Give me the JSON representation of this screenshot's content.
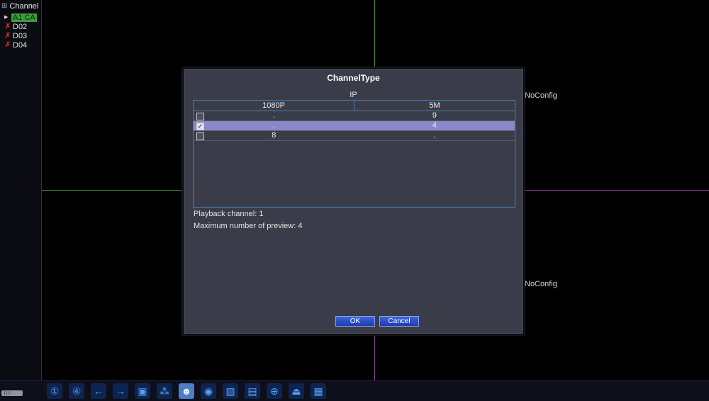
{
  "sidebar": {
    "header_glyph": "⊞",
    "title": "Channel",
    "items": [
      {
        "name": "A1",
        "glyph": "▶",
        "label": "A1 CA",
        "state": "selected"
      },
      {
        "name": "D02",
        "glyph": "✗",
        "label": "D02",
        "state": "no-signal"
      },
      {
        "name": "D03",
        "glyph": "✗",
        "label": "D03",
        "state": "no-signal"
      },
      {
        "name": "D04",
        "glyph": "✗",
        "label": "D04",
        "state": "no-signal"
      }
    ]
  },
  "video": {
    "overlays": [
      {
        "label": "NoConfig",
        "position": "top-right"
      },
      {
        "label": "NoConfig",
        "position": "bottom-right"
      }
    ]
  },
  "dialog": {
    "title": "ChannelType",
    "section_label": "IP",
    "table": {
      "columns": [
        "1080P",
        "5M"
      ],
      "rows": [
        {
          "check": "",
          "checked": false,
          "selected": false,
          "values": [
            ".",
            "9"
          ]
        },
        {
          "check": "✓",
          "checked": true,
          "selected": true,
          "values": [
            ".",
            "4"
          ]
        },
        {
          "check": "",
          "checked": false,
          "selected": false,
          "values": [
            "8",
            "."
          ]
        }
      ]
    },
    "info_lines": [
      "Playback channel: 1",
      "Maximum number of preview: 4"
    ],
    "buttons": {
      "ok": "OK",
      "cancel": "Cancel"
    }
  },
  "toolbar": {
    "buttons": [
      {
        "name": "single-screen-view",
        "glyph": "①"
      },
      {
        "name": "quad-screen-view",
        "glyph": "④"
      },
      {
        "name": "previous-page",
        "glyph": "←"
      },
      {
        "name": "next-page",
        "glyph": "→"
      },
      {
        "name": "pip-view",
        "glyph": "▣"
      },
      {
        "name": "tour",
        "glyph": "⁂"
      },
      {
        "name": "account",
        "glyph": "☻",
        "active": true
      },
      {
        "name": "ptz-control",
        "glyph": "◉"
      },
      {
        "name": "color-setting",
        "glyph": "▨"
      },
      {
        "name": "output-adjust",
        "glyph": "▤"
      },
      {
        "name": "network",
        "glyph": "⊕"
      },
      {
        "name": "storage-eject",
        "glyph": "⏏"
      },
      {
        "name": "channel-type-grid",
        "glyph": "▦"
      }
    ]
  },
  "colors": {
    "selected_channel_green": "#3f9b3f",
    "offline_red": "#d42626",
    "row_highlight": "#8a88c9",
    "table_border": "#4d7ba6",
    "button_blue": "#2647c8",
    "grid_green": "#4d8f3f",
    "grid_purple": "#8a4a8a"
  }
}
